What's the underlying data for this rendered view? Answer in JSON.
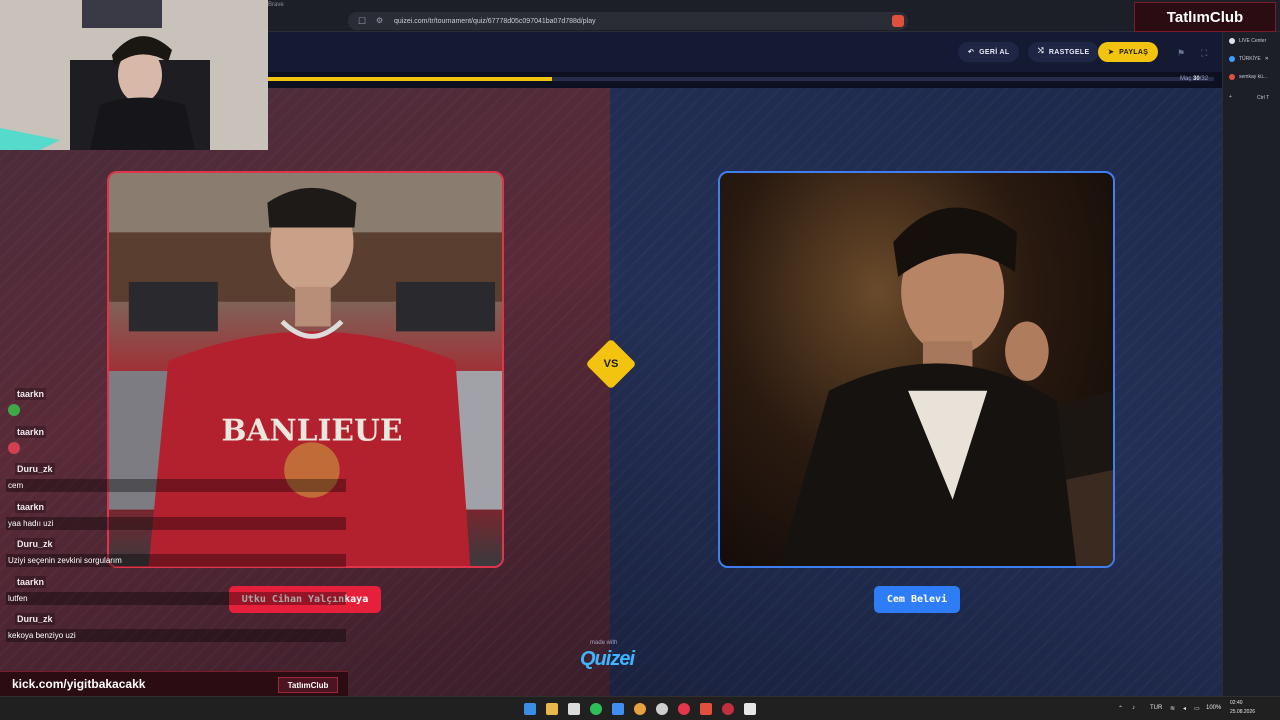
{
  "browser": {
    "tab_title": "Brave",
    "url": "quizei.com/tr/tournament/quiz/67778d05c097041ba07d788d/play"
  },
  "brand_overlay": "TatlımClub",
  "header": {
    "back_label": "GERİ AL",
    "random_label": "RASTGELE",
    "share_label": "PAYLAŞ"
  },
  "progress": {
    "fraction": 0.3,
    "label_prefix": "Maç",
    "current": "30",
    "total": "/32"
  },
  "match": {
    "vs_label": "VS",
    "left_name": "Utku Cihan Yalçınkaya",
    "right_name": "Cem Belevi",
    "left_sweater_text": "BANLIEUE"
  },
  "footer_brand": {
    "made_with": "made with",
    "logo": "Quizei"
  },
  "side_panel": {
    "items": [
      "LIVE Center",
      "TÜRKİYE",
      "semkay kü...",
      "+",
      "Ctrl T"
    ]
  },
  "chat": [
    {
      "user": "taarkn",
      "text": "",
      "emote": "#3ea84a"
    },
    {
      "user": "taarkn",
      "text": "",
      "emote": "#d04050"
    },
    {
      "user": "Duru_zk",
      "text": "cem"
    },
    {
      "user": "taarkn",
      "text": "yaa hadıı uzi"
    },
    {
      "user": "Duru_zk",
      "text": "Uziyi seçenin zevkini sorgularım"
    },
    {
      "user": "taarkn",
      "text": "lutfen"
    },
    {
      "user": "Duru_zk",
      "text": "kekoya benziyo uzi"
    }
  ],
  "stream_footer": {
    "url": "kick.com/yigitbakacakk",
    "badge": "TatlımClub"
  },
  "taskbar": {
    "lang": "TUR",
    "battery": "100%",
    "time": "02:40",
    "date": "25.08.2026"
  },
  "colors": {
    "accent_yellow": "#f2c40f",
    "left_red": "#e6203a",
    "right_blue": "#2f7df6"
  }
}
